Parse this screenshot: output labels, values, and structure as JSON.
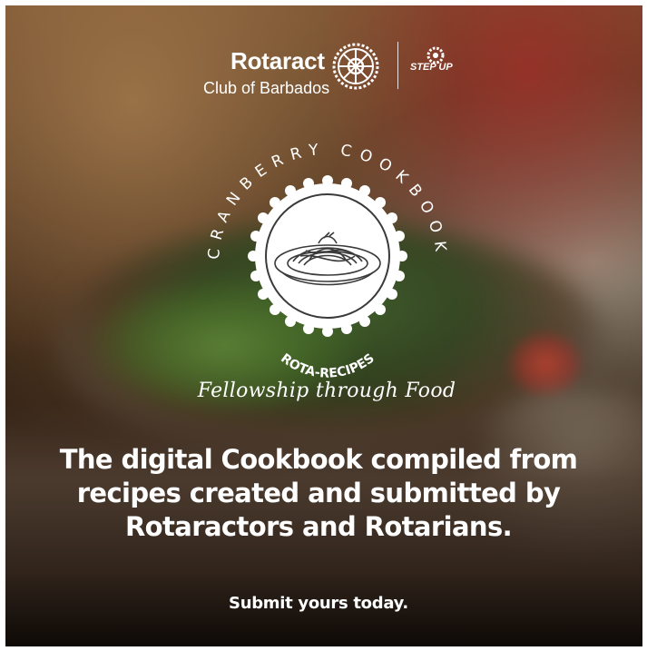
{
  "logos": {
    "org_name": "Rotaract",
    "org_sub": "Club of Barbados",
    "partner_logo": "STEP UP"
  },
  "emblem": {
    "arc_text": "CRANBERRY COOKBOOK",
    "badge_text": "ROTA-RECIPES",
    "icon": "spaghetti-plate-icon"
  },
  "tagline": "Fellowship through Food",
  "headline": "The digital Cookbook compiled from recipes created and submitted by Rotaractors and Rotarians.",
  "cta": "Submit yours today.",
  "colors": {
    "text": "#ffffff",
    "emblem_fill": "#ffffff",
    "emblem_line": "#3a3a3a"
  }
}
